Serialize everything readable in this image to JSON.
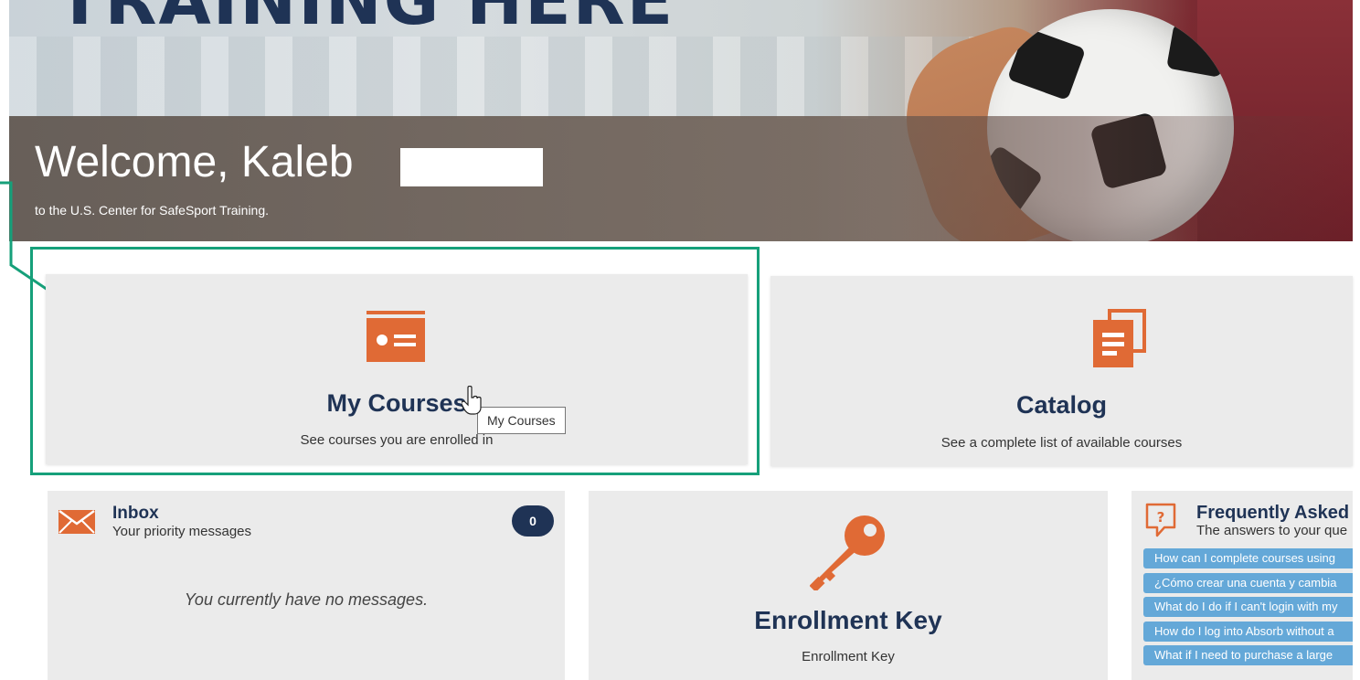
{
  "hero": {
    "banner_text": "TRAINING HERE",
    "welcome": "Welcome, Kaleb",
    "subtitle": "to the U.S. Center for SafeSport Training."
  },
  "tiles": {
    "my_courses": {
      "title": "My Courses",
      "description": "See courses you are enrolled in",
      "tooltip": "My Courses",
      "icon": "course-card-icon"
    },
    "catalog": {
      "title": "Catalog",
      "description": "See a complete list of available courses",
      "icon": "catalog-icon"
    }
  },
  "inbox": {
    "title": "Inbox",
    "subtitle": "Your priority messages",
    "count": "0",
    "empty_message": "You currently have no messages.",
    "icon": "envelope-icon"
  },
  "enrollment": {
    "title": "Enrollment Key",
    "description": "Enrollment Key",
    "icon": "key-icon"
  },
  "faq": {
    "title": "Frequently Asked",
    "subtitle": "The answers to your que",
    "icon": "question-bubble-icon",
    "items": [
      "How can I complete courses using",
      "¿Cómo crear una cuenta y cambia",
      "What do I do if I can't login with my",
      "How do I log into Absorb without a",
      "What if I need to purchase a large"
    ]
  },
  "colors": {
    "accent": "#e06a35",
    "navy": "#1f3355",
    "annotation": "#16a07a",
    "faq_link": "#64a8d8",
    "tile_bg": "#ebebeb"
  }
}
